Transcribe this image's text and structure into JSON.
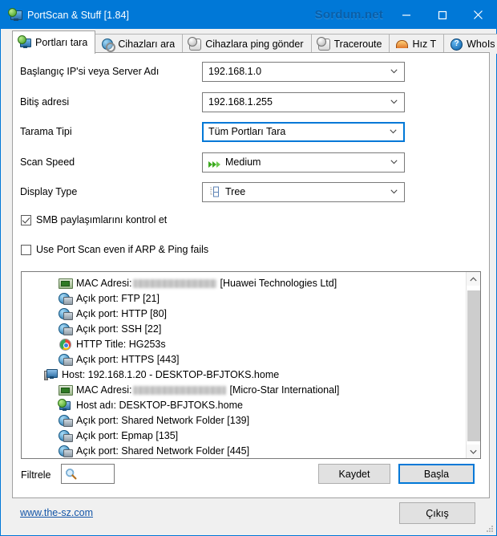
{
  "window": {
    "title": "PortScan & Stuff [1.84]",
    "watermark": "Sordum.net",
    "icon": "monitor-globe-icon",
    "minimize": "—",
    "maximize": "☐",
    "close": "✕"
  },
  "tabs": {
    "items": [
      {
        "label": "Portları tara",
        "icon": "monitor-globe-icon",
        "active": true
      },
      {
        "label": "Cihazları ara",
        "icon": "globe-magnifier-icon",
        "active": false
      },
      {
        "label": "Cihazlara ping gönder",
        "icon": "clock-ping-icon",
        "active": false
      },
      {
        "label": "Traceroute",
        "icon": "clock-route-icon",
        "active": false
      },
      {
        "label": "Hız T",
        "icon": "gauge-icon",
        "active": false
      },
      {
        "label": "WhoIs",
        "icon": "help-circle-icon",
        "active": false
      }
    ],
    "scroll_prev": "◂",
    "scroll_next": "▸"
  },
  "form": {
    "start_ip": {
      "label": "Başlangıç IP'si veya Server Adı",
      "value": "192.168.1.0"
    },
    "end_ip": {
      "label": "Bitiş adresi",
      "value": "192.168.1.255"
    },
    "scan_type": {
      "label": "Tarama Tipi",
      "value": "Tüm Portları Tara"
    },
    "scan_speed": {
      "label": "Scan Speed",
      "value": "Medium",
      "icon": "fast-forward-icon"
    },
    "display_type": {
      "label": "Display Type",
      "value": "Tree",
      "icon": "tree-icon"
    },
    "smb_check": {
      "label": "SMB paylaşımlarını kontrol et",
      "checked": true
    },
    "arp_fallback": {
      "label": "Use Port Scan even if ARP & Ping fails",
      "checked": false
    }
  },
  "results": [
    {
      "indent": 2,
      "icon": "network-card-icon",
      "prefix": "MAC Adresi:",
      "redacted": true,
      "suffix": "[Huawei Technologies Ltd]"
    },
    {
      "indent": 2,
      "icon": "open-port-icon",
      "text": "Açık port: FTP [21]"
    },
    {
      "indent": 2,
      "icon": "open-port-icon",
      "text": "Açık port: HTTP [80]"
    },
    {
      "indent": 2,
      "icon": "open-port-icon",
      "text": "Açık port: SSH [22]"
    },
    {
      "indent": 2,
      "icon": "browser-icon",
      "text": "HTTP Title: HG253s"
    },
    {
      "indent": 2,
      "icon": "open-port-icon",
      "text": "Açık port: HTTPS [443]"
    },
    {
      "indent": 1,
      "icon": "host-icon",
      "text": "Host: 192.168.1.20 - DESKTOP-BFJTOKS.home"
    },
    {
      "indent": 2,
      "icon": "network-card-icon",
      "prefix": "MAC Adresi:",
      "redacted": true,
      "suffix": "[Micro-Star International]"
    },
    {
      "indent": 2,
      "icon": "hostname-icon",
      "text": "Host adı: DESKTOP-BFJTOKS.home"
    },
    {
      "indent": 2,
      "icon": "open-port-icon",
      "text": "Açık port: Shared Network Folder [139]"
    },
    {
      "indent": 2,
      "icon": "open-port-icon",
      "text": "Açık port: Epmap [135]"
    },
    {
      "indent": 2,
      "icon": "open-port-icon",
      "text": "Açık port: Shared Network Folder [445]"
    }
  ],
  "bottom": {
    "filter_label": "Filtrele",
    "filter_value": "",
    "filter_placeholder": "",
    "save_label": "Kaydet",
    "start_label": "Başla"
  },
  "footer": {
    "link": "www.the-sz.com",
    "exit_label": "Çıkış"
  },
  "colors": {
    "titlebar": "#0078d7",
    "accent": "#0078d7",
    "window_bg": "#f0f0f0",
    "page_bg": "#ffffff",
    "link": "#1556a8",
    "button_face": "#e1e1e1",
    "speed_green": "#3ba91e"
  }
}
